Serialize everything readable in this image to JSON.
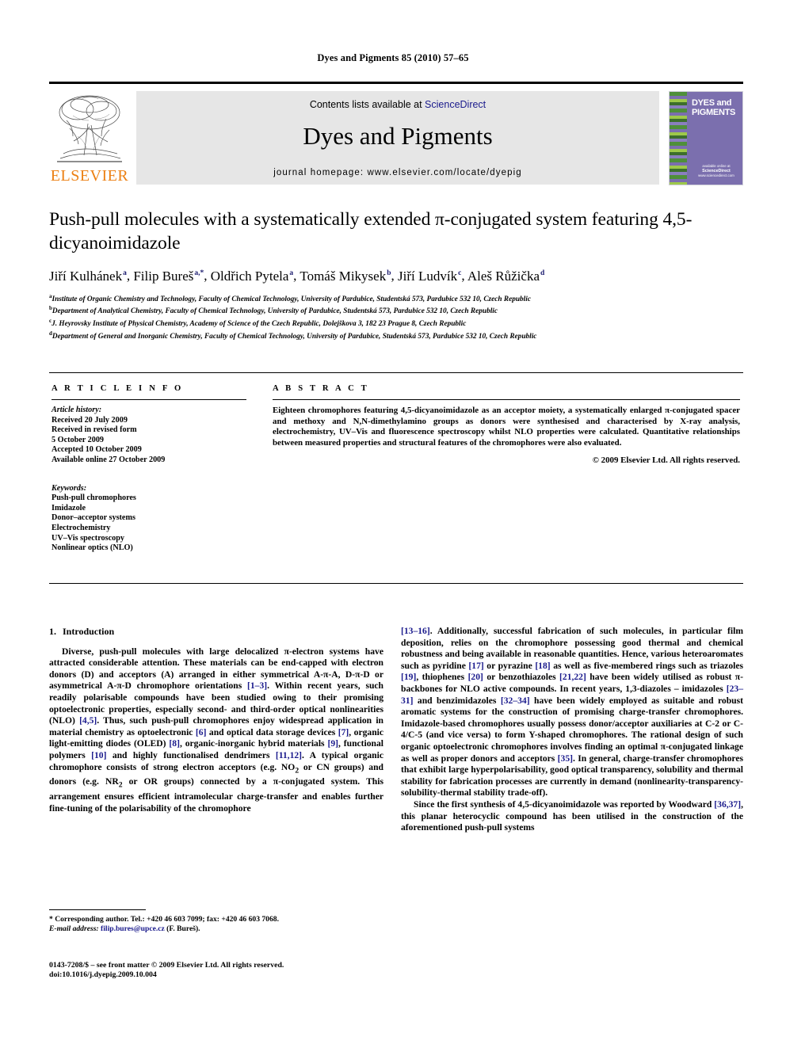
{
  "running_head": "Dyes and Pigments 85 (2010) 57–65",
  "masthead": {
    "contents_prefix": "Contents lists available at ",
    "sciencedirect": "ScienceDirect",
    "journal_name": "Dyes and Pigments",
    "homepage": "journal homepage: www.elsevier.com/locate/dyepig",
    "publisher": "ELSEVIER",
    "cover_title": "DYES and PIGMENTS",
    "cover_footer_top": "available online at",
    "cover_footer_mark": "ScienceDirect",
    "cover_footer_url": "www.sciencedirect.com",
    "accent_orange": "#ec8013",
    "link_blue": "#1a1a8c",
    "cover_purple": "#7b6fae",
    "band_grey": "#e6e6e6"
  },
  "title": "Push-pull molecules with a systematically extended π-conjugated system featuring 4,5-dicyanoimidazole",
  "authors": [
    {
      "name": "Jiří Kulhánek",
      "marks": "a"
    },
    {
      "name": "Filip Bureš",
      "marks": "a,*"
    },
    {
      "name": "Oldřich Pytela",
      "marks": "a"
    },
    {
      "name": "Tomáš Mikysek",
      "marks": "b"
    },
    {
      "name": "Jiří Ludvík",
      "marks": "c"
    },
    {
      "name": "Aleš Růžička",
      "marks": "d"
    }
  ],
  "affiliations": [
    {
      "mark": "a",
      "text": "Institute of Organic Chemistry and Technology, Faculty of Chemical Technology, University of Pardubice, Studentská 573, Pardubice 532 10, Czech Republic"
    },
    {
      "mark": "b",
      "text": "Department of Analytical Chemistry, Faculty of Chemical Technology, University of Pardubice, Studentská 573, Pardubice 532 10, Czech Republic"
    },
    {
      "mark": "c",
      "text": "J. Heyrovsky Institute of Physical Chemistry, Academy of Science of the Czech Republic, Dolejškova 3, 182 23 Prague 8, Czech Republic"
    },
    {
      "mark": "d",
      "text": "Department of General and Inorganic Chemistry, Faculty of Chemical Technology, University of Pardubice, Studentská 573, Pardubice 532 10, Czech Republic"
    }
  ],
  "article_info": {
    "heading": "A R T I C L E   I N F O",
    "history_label": "Article history:",
    "history": [
      "Received 20 July 2009",
      "Received in revised form",
      "5 October 2009",
      "Accepted 10 October 2009",
      "Available online 27 October 2009"
    ],
    "keywords_label": "Keywords:",
    "keywords": [
      "Push-pull chromophores",
      "Imidazole",
      "Donor–acceptor systems",
      "Electrochemistry",
      "UV–Vis spectroscopy",
      "Nonlinear optics (NLO)"
    ]
  },
  "abstract": {
    "heading": "A B S T R A C T",
    "text": "Eighteen chromophores featuring 4,5-dicyanoimidazole as an acceptor moiety, a systematically enlarged π-conjugated spacer and methoxy and N,N-dimethylamino groups as donors were synthesised and characterised by X-ray analysis, electrochemistry, UV–Vis and fluorescence spectroscopy whilst NLO properties were calculated. Quantitative relationships between measured properties and structural features of the chromophores were also evaluated.",
    "copyright": "© 2009 Elsevier Ltd. All rights reserved."
  },
  "introduction": {
    "number": "1.",
    "heading": "Introduction"
  },
  "footnote": {
    "corresponding": "* Corresponding author. Tel.: +420 46 603 7099; fax: +420 46 603 7068.",
    "email_label": "E-mail address:",
    "email": "filip.bures@upce.cz",
    "email_suffix": "(F. Bureš)."
  },
  "imprint": {
    "issn_line": "0143-7208/$ – see front matter © 2009 Elsevier Ltd. All rights reserved.",
    "doi_line": "doi:10.1016/j.dyepig.2009.10.004"
  }
}
